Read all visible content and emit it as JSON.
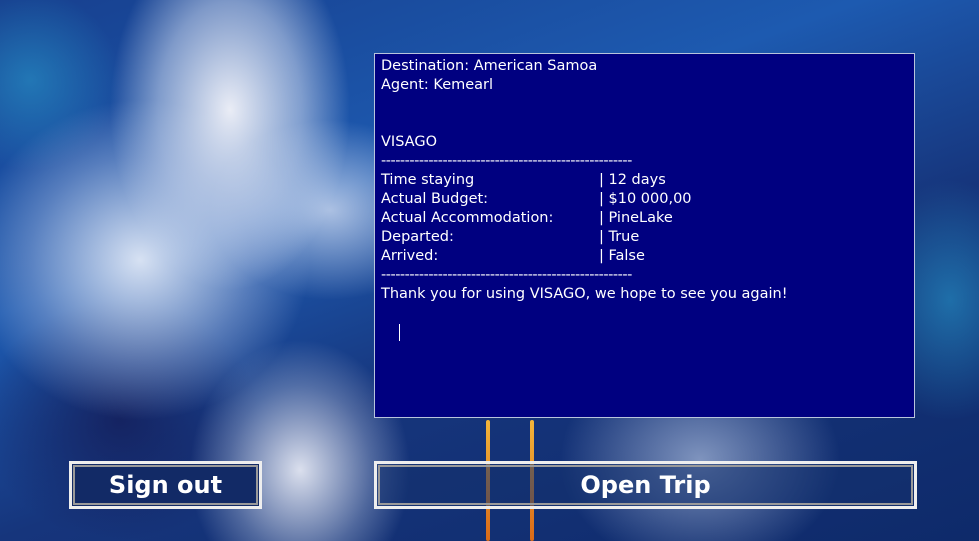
{
  "terminal": {
    "destination": "Destination: American Samoa",
    "agent": "Agent: Kemearl",
    "brand": "VISAGO",
    "separator": "-----------------------------------------------------",
    "rows": [
      {
        "key": "Time staying",
        "value": "| 12 days"
      },
      {
        "key": "Actual Budget:",
        "value": "| $10 000,00"
      },
      {
        "key": "Actual Accommodation:",
        "value": "| PineLake"
      },
      {
        "key": "Departed:",
        "value": "| True"
      },
      {
        "key": "Arrived:",
        "value": "| False"
      }
    ],
    "thanks": "Thank you for using VISAGO, we hope to see you again!"
  },
  "buttons": {
    "sign_out": "Sign out",
    "open_trip": "Open Trip"
  },
  "colors": {
    "terminal_bg": "#000080",
    "terminal_text": "#ffffff",
    "button_border": "#eeeeee"
  }
}
